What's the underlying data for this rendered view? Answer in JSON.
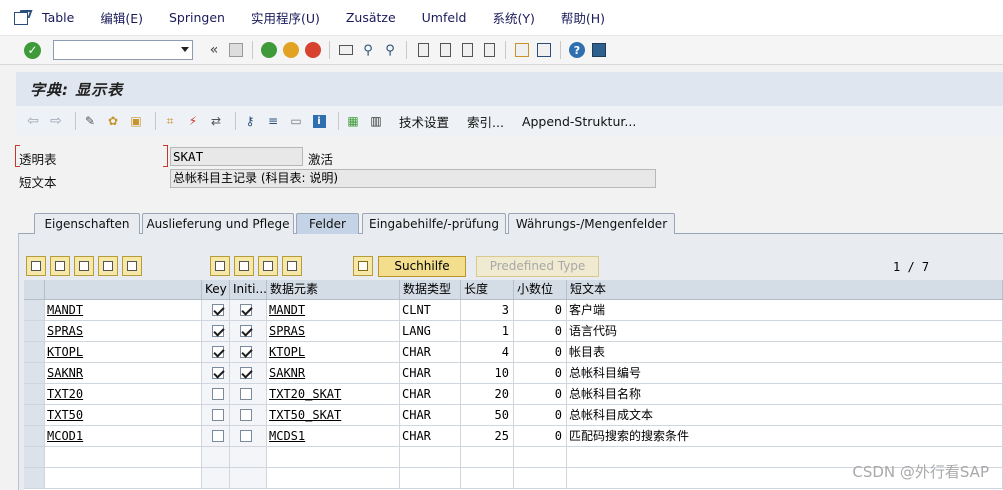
{
  "menu": {
    "items": [
      "Table",
      "编辑(E)",
      "Springen",
      "实用程序(U)",
      "Zusätze",
      "Umfeld",
      "系统(Y)",
      "帮助(H)"
    ]
  },
  "title": "字典: 显示表",
  "app_toolbar": {
    "tech_settings": "技术设置",
    "index": "索引...",
    "append": "Append-Struktur..."
  },
  "header": {
    "table_label": "透明表",
    "table_value": "SKAT",
    "status": "激活",
    "short_text_label": "短文本",
    "short_text_value": "总帐科目主记录 (科目表: 说明)"
  },
  "tabs": [
    "Eigenschaften",
    "Auslieferung und Pflege",
    "Felder",
    "Eingabehilfe/-prüfung",
    "Währungs-/Mengenfelder"
  ],
  "active_tab": "Felder",
  "grid_toolbar": {
    "search_help": "Suchhilfe",
    "predefined_type": "Predefined Type",
    "pager": "1 / 7"
  },
  "columns": [
    "",
    "Key",
    "Initi...",
    "数据元素",
    "数据类型",
    "长度",
    "小数位",
    "短文本"
  ],
  "rows": [
    {
      "field": "MANDT",
      "key": true,
      "init": true,
      "element": "MANDT",
      "type": "CLNT",
      "length": "3",
      "decimals": "0",
      "text": "客户端"
    },
    {
      "field": "SPRAS",
      "key": true,
      "init": true,
      "element": "SPRAS",
      "type": "LANG",
      "length": "1",
      "decimals": "0",
      "text": "语言代码"
    },
    {
      "field": "KTOPL",
      "key": true,
      "init": true,
      "element": "KTOPL",
      "type": "CHAR",
      "length": "4",
      "decimals": "0",
      "text": "帐目表"
    },
    {
      "field": "SAKNR",
      "key": true,
      "init": true,
      "element": "SAKNR",
      "type": "CHAR",
      "length": "10",
      "decimals": "0",
      "text": "总帐科目编号"
    },
    {
      "field": "TXT20",
      "key": false,
      "init": false,
      "element": "TXT20_SKAT",
      "type": "CHAR",
      "length": "20",
      "decimals": "0",
      "text": "总帐科目名称"
    },
    {
      "field": "TXT50",
      "key": false,
      "init": false,
      "element": "TXT50_SKAT",
      "type": "CHAR",
      "length": "50",
      "decimals": "0",
      "text": "总帐科目成文本"
    },
    {
      "field": "MCOD1",
      "key": false,
      "init": false,
      "element": "MCDS1",
      "type": "CHAR",
      "length": "25",
      "decimals": "0",
      "text": "匹配码搜索的搜索条件"
    }
  ],
  "watermark": "CSDN @外行看SAP"
}
